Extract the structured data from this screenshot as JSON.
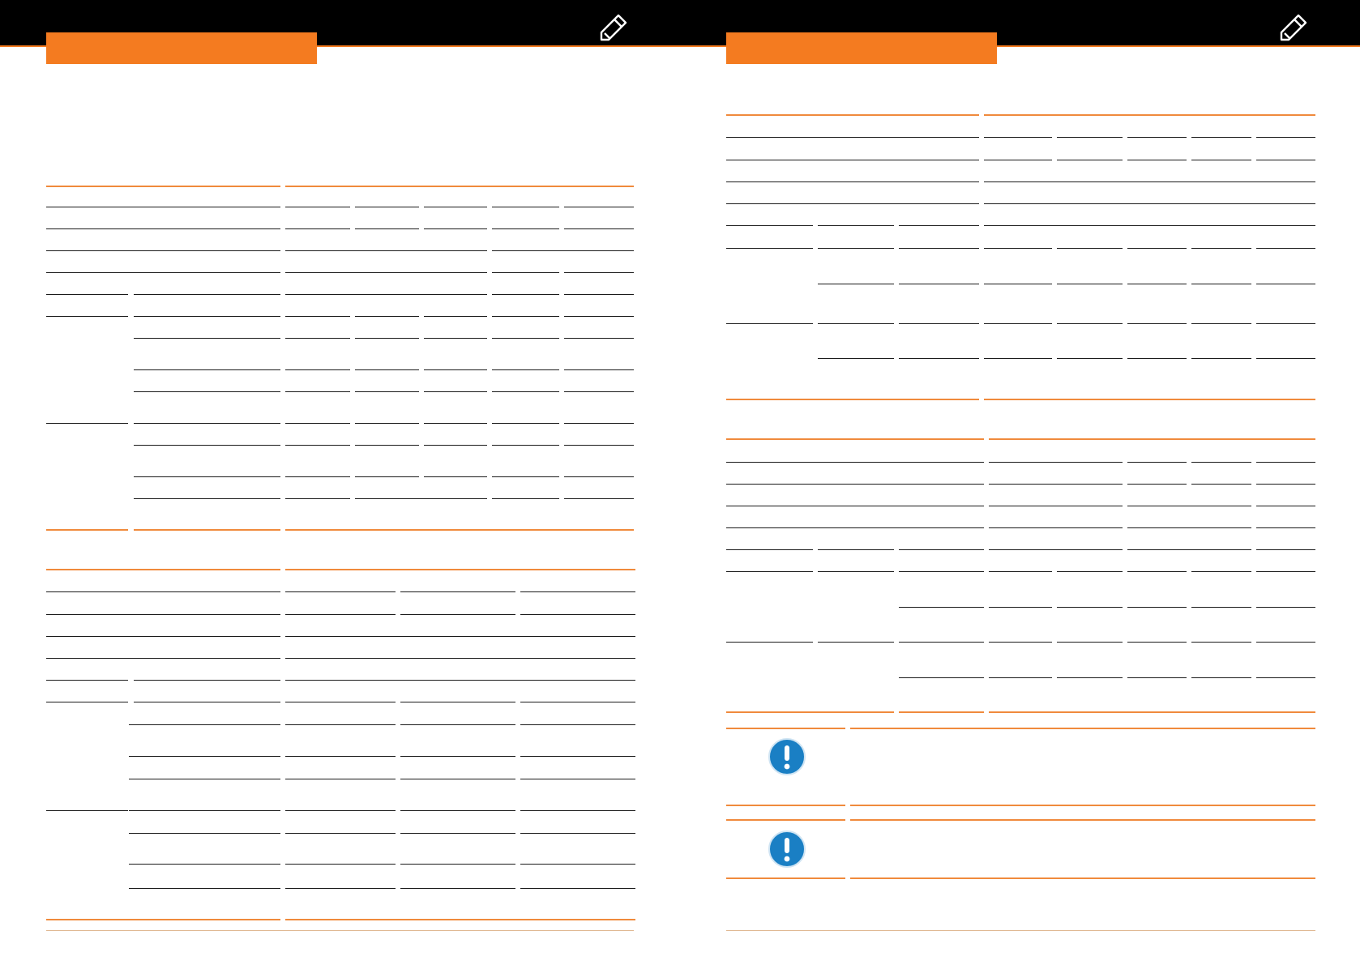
{
  "colors": {
    "header": "#000000",
    "accent": "#f47b20",
    "rule": "#1a1a1a",
    "notice": "#1a7fc4"
  },
  "icons": {
    "header_edit": "pencil-icon",
    "notice": "exclamation-circle-icon"
  }
}
